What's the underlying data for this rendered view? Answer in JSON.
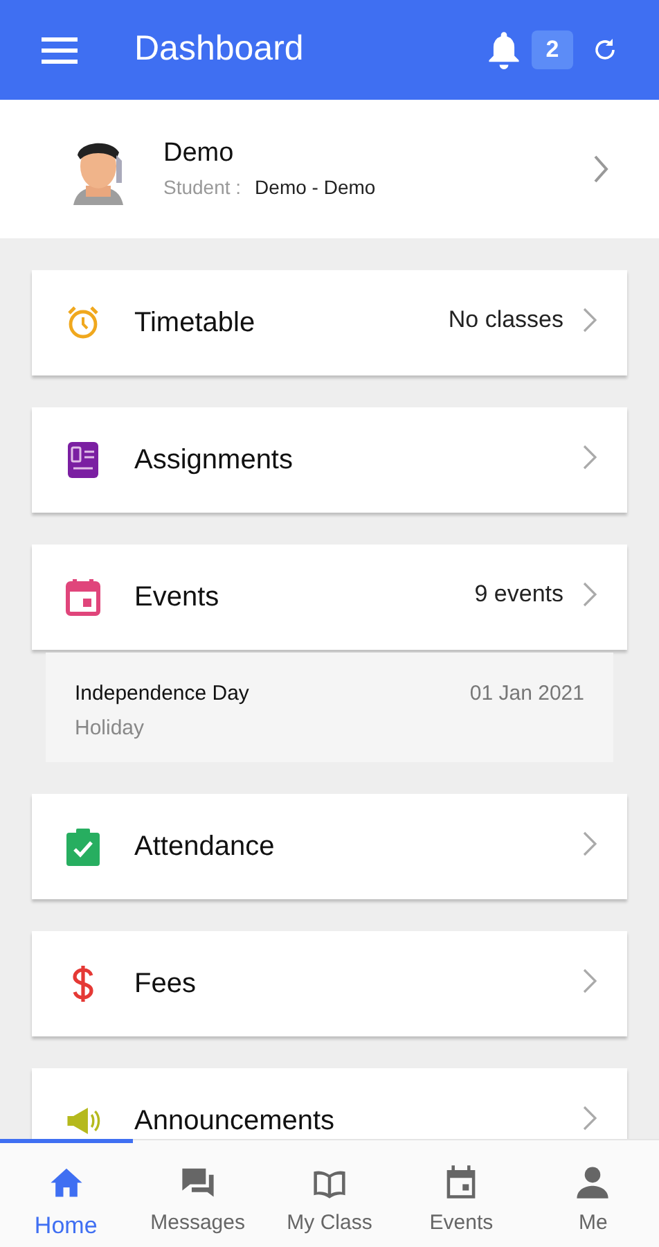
{
  "app_bar": {
    "title": "Dashboard",
    "notification_count": "2"
  },
  "profile": {
    "name": "Demo",
    "role_label": "Student :",
    "class_name": "Demo - Demo"
  },
  "cards": [
    {
      "title": "Timetable",
      "summary": "No classes"
    },
    {
      "title": "Assignments"
    },
    {
      "title": "Events",
      "summary": "9 events",
      "items": [
        {
          "title": "Independence Day",
          "type": "Holiday",
          "date": "01 Jan 2021"
        }
      ]
    },
    {
      "title": "Attendance"
    },
    {
      "title": "Fees"
    },
    {
      "title": "Announcements"
    }
  ],
  "bottom_nav": [
    {
      "label": "Home",
      "selected": true
    },
    {
      "label": "Messages",
      "selected": false
    },
    {
      "label": "My Class",
      "selected": false
    },
    {
      "label": "Events",
      "selected": false
    },
    {
      "label": "Me",
      "selected": false
    }
  ]
}
